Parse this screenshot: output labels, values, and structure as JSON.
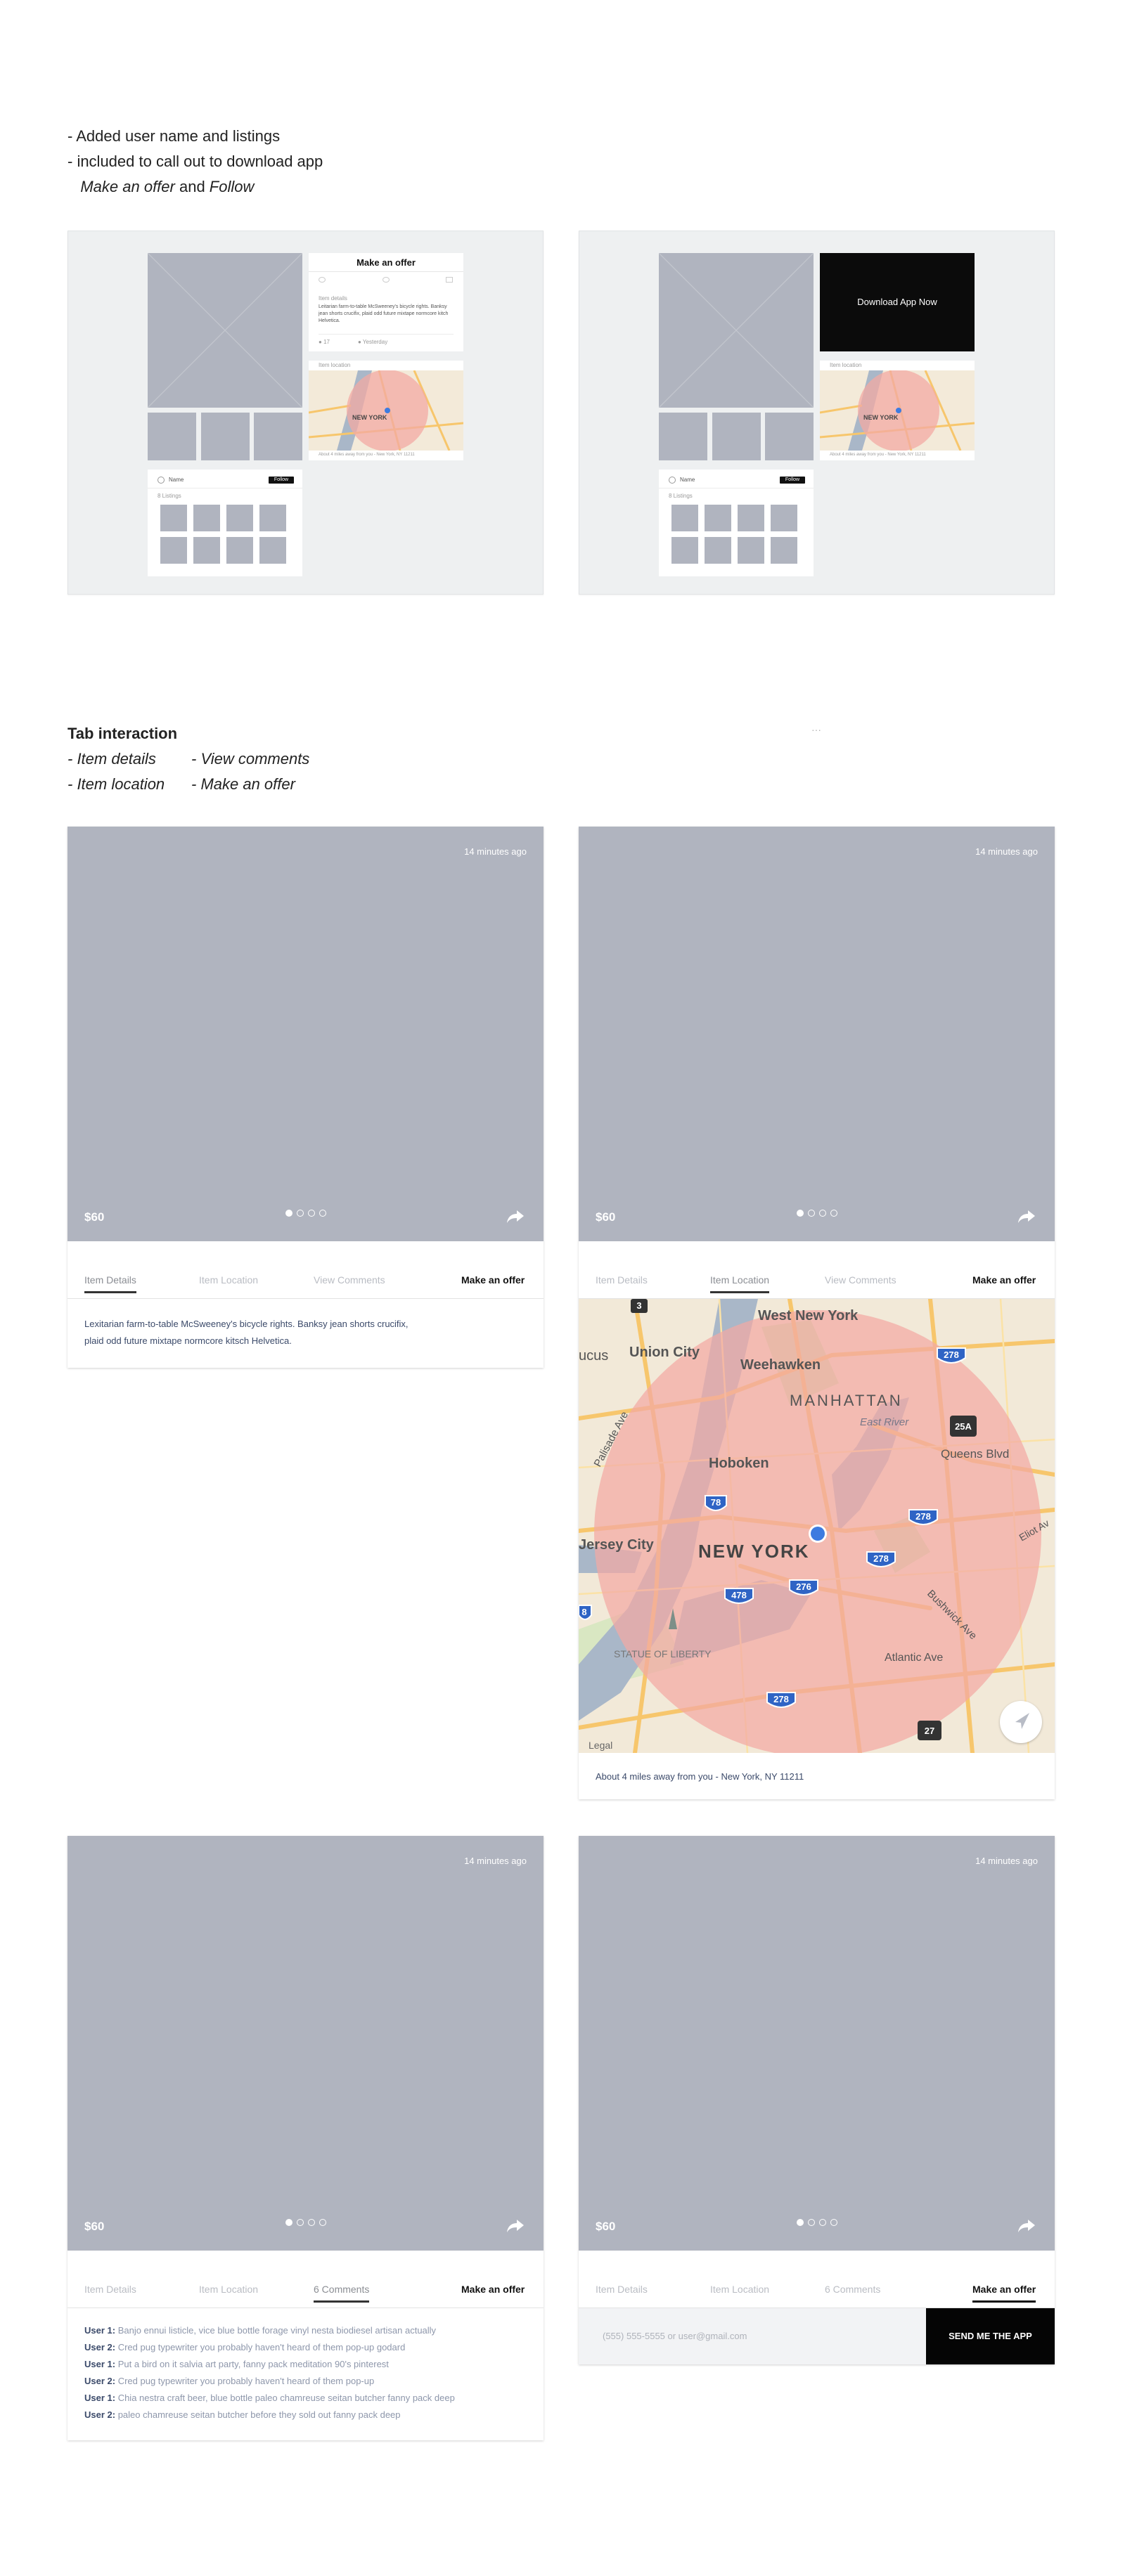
{
  "notes": {
    "top": {
      "line1": "- Added user name and listings",
      "line2": "- included to call out to download app",
      "line3_a": "Make an offer",
      "line3_b": " and ",
      "line3_c": "Follow"
    },
    "tabs_title": "Tab interaction",
    "tabs_list": {
      "a": "- Item details",
      "b": "- Item location",
      "c": "- View comments",
      "d": "- Make an offer"
    },
    "ellipsis": "···"
  },
  "wire": {
    "offer_title": "Make an offer",
    "download_label": "Download App Now",
    "item_details_head": "Item details",
    "item_details_text": "Leitarian farm-to-table McSweeney's bicycle rights. Banksy jean shorts crucifix, plaid odd future mixtape normcore kitch Helvetica.",
    "likes": "17",
    "date": "Yesterday",
    "item_location_head": "Item location",
    "map_caption": "About 4 miles away from you - New York, NY 11211",
    "user_name": "Name",
    "follow_label": "Follow",
    "listings_count": "8 Listings"
  },
  "item": {
    "timestamp": "14 minutes ago",
    "price": "$60",
    "description": [
      "Lexitarian farm-to-table McSweeney's bicycle rights. Banksy jean shorts crucifix,",
      "plaid odd future mixtape normcore kitsch Helvetica."
    ],
    "location_text": "About 4 miles away from you - New York, NY 11211"
  },
  "tabs": {
    "details": "Item Details",
    "location": "Item Location",
    "comments": "View Comments",
    "comments_count": "6 Comments",
    "offer": "Make an offer"
  },
  "comments": [
    {
      "user": "User 1:",
      "text": " Banjo ennui listicle, vice blue bottle forage vinyl nesta biodiesel artisan actually"
    },
    {
      "user": "User 2:",
      "text": " Cred pug typewriter you probably haven't heard of them pop-up godard"
    },
    {
      "user": "User 1:",
      "text": " Put a bird on it salvia art party, fanny pack meditation 90's pinterest"
    },
    {
      "user": "User 2:",
      "text": " Cred pug typewriter you probably haven't heard of them pop-up"
    },
    {
      "user": "User 1:",
      "text": " Chia nestra craft beer, blue bottle paleo chamreuse seitan butcher fanny pack deep"
    },
    {
      "user": "User 2:",
      "text": " paleo chamreuse seitan butcher before they sold out fanny pack deep"
    }
  ],
  "offer_form": {
    "placeholder": "(555) 555-5555 or user@gmail.com",
    "send_label": "SEND ME THE APP"
  },
  "map": {
    "labels": {
      "west_new_york": "West New York",
      "union_city": "Union City",
      "weehawken": "Weehawken",
      "manhattan": "MANHATTAN",
      "east_river": "East River",
      "hoboken": "Hoboken",
      "queens_blvd": "Queens Blvd",
      "jersey_city": "Jersey City",
      "new_york": "NEW YORK",
      "palisade_ave": "Palisade Ave",
      "statue_of_liberty": "STATUE OF LIBERTY",
      "atlantic_ave": "Atlantic Ave",
      "bushwick_ave": "Bushwick Ave",
      "eliot_av": "Eliot Av",
      "legal": "Legal",
      "ucus": "ucus"
    },
    "shields": {
      "s3": "3",
      "s278a": "278",
      "s278b": "278",
      "s278c": "278",
      "s278d": "278",
      "s25a": "25A",
      "s78": "78",
      "s276": "276",
      "s478": "478",
      "s27": "27",
      "s8": "8"
    }
  },
  "colors": {
    "placeholder": "#b0b4bf",
    "panel": "#eef0f1",
    "radius_fill": "#f3a9a3",
    "text_blue": "#3b4a6a",
    "location_dot": "#3d7be0"
  }
}
